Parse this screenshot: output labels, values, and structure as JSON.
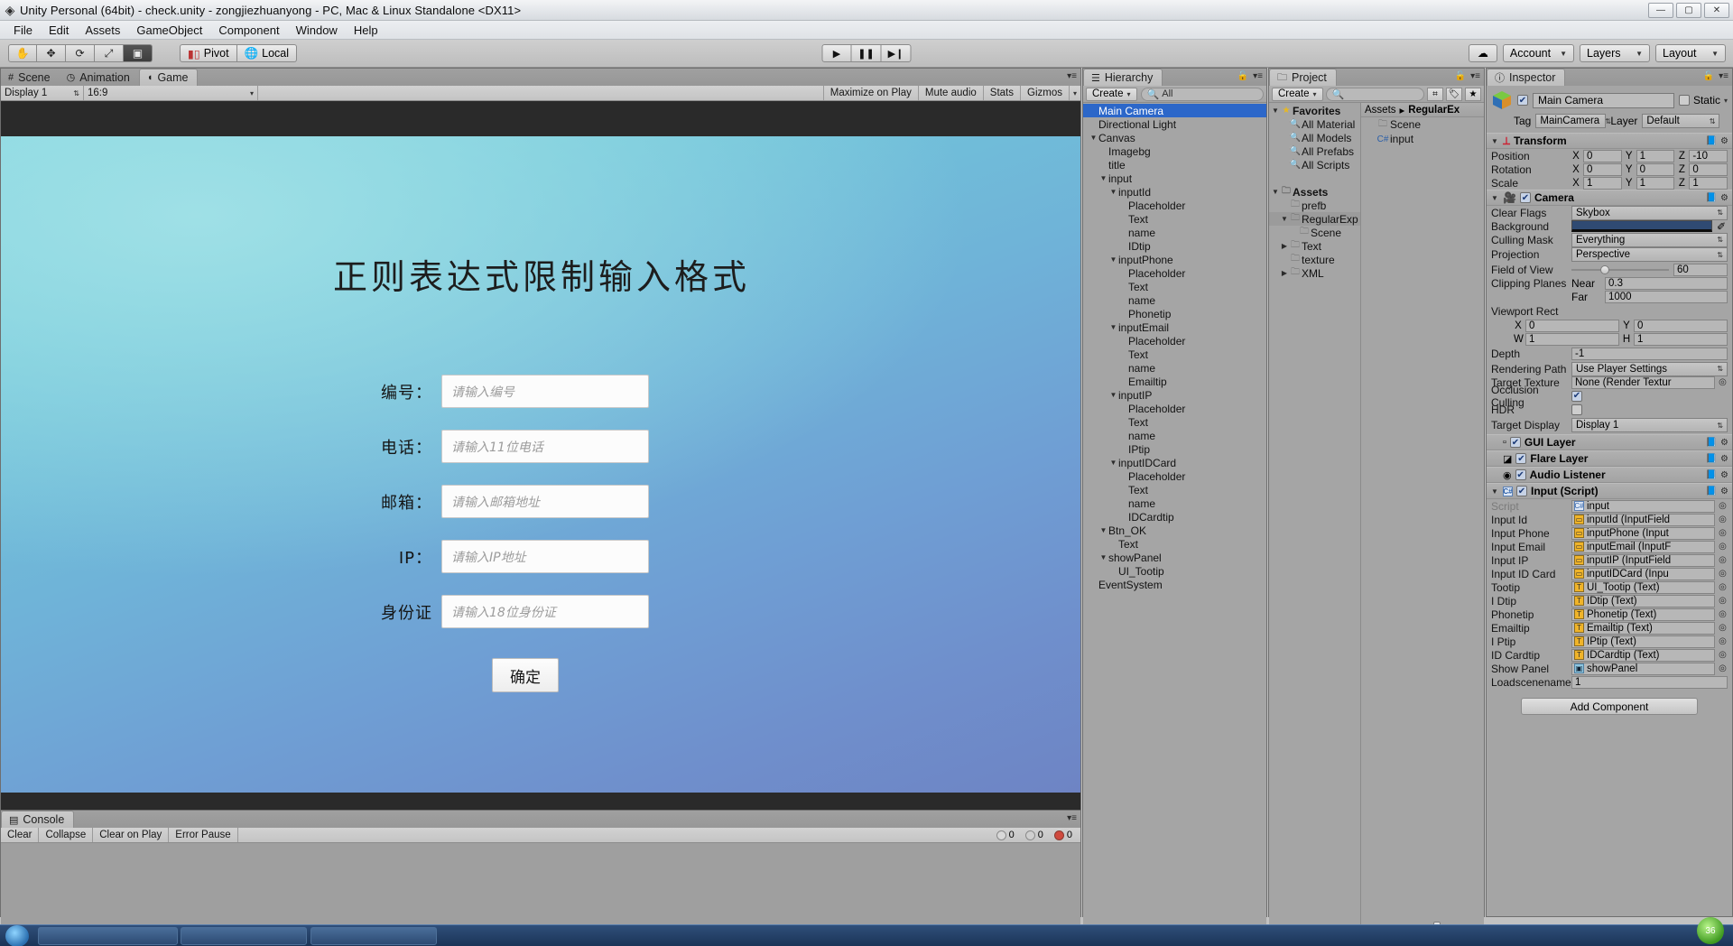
{
  "window": {
    "title": "Unity Personal (64bit) - check.unity - zongjiezhuanyong - PC, Mac & Linux Standalone <DX11>",
    "logo": "unity-logo",
    "minimize": "—",
    "maximize": "▢",
    "close": "✕"
  },
  "menu": {
    "items": [
      "File",
      "Edit",
      "Assets",
      "GameObject",
      "Component",
      "Window",
      "Help"
    ]
  },
  "toolbar": {
    "tools": [
      {
        "name": "hand-tool",
        "glyph": "✋"
      },
      {
        "name": "move-tool",
        "glyph": "✥"
      },
      {
        "name": "rotate-tool",
        "glyph": "⟳"
      },
      {
        "name": "scale-tool",
        "glyph": "⤢"
      },
      {
        "name": "rect-tool",
        "glyph": "▣"
      }
    ],
    "pivot": "Pivot",
    "local": "Local",
    "play": "▶",
    "pause": "❚❚",
    "step": "▶❙",
    "cloud": "☁",
    "account": "Account",
    "layers": "Layers",
    "layout": "Layout"
  },
  "gameview": {
    "tabs": [
      {
        "label": "Scene",
        "icon": "grid-icon",
        "active": false
      },
      {
        "label": "Animation",
        "icon": "clock-icon",
        "active": false
      },
      {
        "label": "Game",
        "icon": "pacman-icon",
        "active": true
      }
    ],
    "display": "Display 1",
    "aspect": "16:9",
    "maximize_on_play": "Maximize on Play",
    "mute_audio": "Mute audio",
    "stats": "Stats",
    "gizmos": "Gizmos"
  },
  "game_content": {
    "title": "正则表达式限制输入格式",
    "fields": [
      {
        "label": "编号：",
        "placeholder": "请输入编号"
      },
      {
        "label": "电话：",
        "placeholder": "请输入11位电话"
      },
      {
        "label": "邮箱：",
        "placeholder": "请输入邮箱地址"
      },
      {
        "label": "IP：",
        "placeholder": "请输入IP地址"
      },
      {
        "label": "身份证",
        "placeholder": "请输入18位身份证"
      }
    ],
    "ok_button": "确定"
  },
  "console": {
    "tab": "Console",
    "buttons": [
      "Clear",
      "Collapse",
      "Clear on Play",
      "Error Pause"
    ],
    "counts": [
      {
        "type": "info",
        "value": "0",
        "color": "#d8d8d8"
      },
      {
        "type": "warning",
        "value": "0",
        "color": "#e8d36a"
      },
      {
        "type": "error",
        "value": "0",
        "color": "#cf4a3e"
      }
    ]
  },
  "hierarchy": {
    "tab": "Hierarchy",
    "create": "Create",
    "search_placeholder": "All",
    "items": [
      {
        "label": "Main Camera",
        "depth": 0,
        "arrow": "",
        "selected": true
      },
      {
        "label": "Directional Light",
        "depth": 0,
        "arrow": "",
        "selected": false
      },
      {
        "label": "Canvas",
        "depth": 0,
        "arrow": "▼",
        "selected": false
      },
      {
        "label": "Imagebg",
        "depth": 1,
        "arrow": "",
        "selected": false
      },
      {
        "label": "title",
        "depth": 1,
        "arrow": "",
        "selected": false
      },
      {
        "label": "input",
        "depth": 1,
        "arrow": "▼",
        "selected": false
      },
      {
        "label": "inputId",
        "depth": 2,
        "arrow": "▼",
        "selected": false
      },
      {
        "label": "Placeholder",
        "depth": 3,
        "arrow": "",
        "selected": false
      },
      {
        "label": "Text",
        "depth": 3,
        "arrow": "",
        "selected": false
      },
      {
        "label": "name",
        "depth": 3,
        "arrow": "",
        "selected": false
      },
      {
        "label": "IDtip",
        "depth": 3,
        "arrow": "",
        "selected": false
      },
      {
        "label": "inputPhone",
        "depth": 2,
        "arrow": "▼",
        "selected": false
      },
      {
        "label": "Placeholder",
        "depth": 3,
        "arrow": "",
        "selected": false
      },
      {
        "label": "Text",
        "depth": 3,
        "arrow": "",
        "selected": false
      },
      {
        "label": "name",
        "depth": 3,
        "arrow": "",
        "selected": false
      },
      {
        "label": "Phonetip",
        "depth": 3,
        "arrow": "",
        "selected": false
      },
      {
        "label": "inputEmail",
        "depth": 2,
        "arrow": "▼",
        "selected": false
      },
      {
        "label": "Placeholder",
        "depth": 3,
        "arrow": "",
        "selected": false
      },
      {
        "label": "Text",
        "depth": 3,
        "arrow": "",
        "selected": false
      },
      {
        "label": "name",
        "depth": 3,
        "arrow": "",
        "selected": false
      },
      {
        "label": "Emailtip",
        "depth": 3,
        "arrow": "",
        "selected": false
      },
      {
        "label": "inputIP",
        "depth": 2,
        "arrow": "▼",
        "selected": false
      },
      {
        "label": "Placeholder",
        "depth": 3,
        "arrow": "",
        "selected": false
      },
      {
        "label": "Text",
        "depth": 3,
        "arrow": "",
        "selected": false
      },
      {
        "label": "name",
        "depth": 3,
        "arrow": "",
        "selected": false
      },
      {
        "label": "IPtip",
        "depth": 3,
        "arrow": "",
        "selected": false
      },
      {
        "label": "inputIDCard",
        "depth": 2,
        "arrow": "▼",
        "selected": false
      },
      {
        "label": "Placeholder",
        "depth": 3,
        "arrow": "",
        "selected": false
      },
      {
        "label": "Text",
        "depth": 3,
        "arrow": "",
        "selected": false
      },
      {
        "label": "name",
        "depth": 3,
        "arrow": "",
        "selected": false
      },
      {
        "label": "IDCardtip",
        "depth": 3,
        "arrow": "",
        "selected": false
      },
      {
        "label": "Btn_OK",
        "depth": 1,
        "arrow": "▼",
        "selected": false
      },
      {
        "label": "Text",
        "depth": 2,
        "arrow": "",
        "selected": false
      },
      {
        "label": "showPanel",
        "depth": 1,
        "arrow": "▼",
        "selected": false
      },
      {
        "label": "UI_Tootip",
        "depth": 2,
        "arrow": "",
        "selected": false
      },
      {
        "label": "EventSystem",
        "depth": 0,
        "arrow": "",
        "selected": false
      }
    ]
  },
  "project": {
    "tab": "Project",
    "create": "Create",
    "search_placeholder": "",
    "breadcrumb": [
      "Assets",
      "RegularEx"
    ],
    "tree": [
      {
        "label": "Favorites",
        "depth": 0,
        "arrow": "▼",
        "icon": "star-icon",
        "bold": true,
        "selected": false
      },
      {
        "label": "All Material",
        "depth": 1,
        "arrow": "",
        "icon": "search-icon",
        "bold": false,
        "selected": false
      },
      {
        "label": "All Models",
        "depth": 1,
        "arrow": "",
        "icon": "search-icon",
        "bold": false,
        "selected": false
      },
      {
        "label": "All Prefabs",
        "depth": 1,
        "arrow": "",
        "icon": "search-icon",
        "bold": false,
        "selected": false
      },
      {
        "label": "All Scripts",
        "depth": 1,
        "arrow": "",
        "icon": "search-icon",
        "bold": false,
        "selected": false
      },
      {
        "label": "",
        "depth": 0,
        "arrow": "",
        "icon": "",
        "bold": false,
        "selected": false
      },
      {
        "label": "Assets",
        "depth": 0,
        "arrow": "▼",
        "icon": "folder-icon",
        "bold": true,
        "selected": false
      },
      {
        "label": "prefb",
        "depth": 1,
        "arrow": "",
        "icon": "folder-icon",
        "bold": false,
        "selected": false
      },
      {
        "label": "RegularExp",
        "depth": 1,
        "arrow": "▼",
        "icon": "folder-icon",
        "bold": false,
        "selected": true
      },
      {
        "label": "Scene",
        "depth": 2,
        "arrow": "",
        "icon": "folder-icon",
        "bold": false,
        "selected": false
      },
      {
        "label": "Text",
        "depth": 1,
        "arrow": "▶",
        "icon": "folder-icon",
        "bold": false,
        "selected": false
      },
      {
        "label": "texture",
        "depth": 1,
        "arrow": "",
        "icon": "folder-icon",
        "bold": false,
        "selected": false
      },
      {
        "label": "XML",
        "depth": 1,
        "arrow": "▶",
        "icon": "folder-icon",
        "bold": false,
        "selected": false
      }
    ],
    "contents": [
      {
        "label": "Scene",
        "icon": "folder-icon"
      },
      {
        "label": "input",
        "icon": "csharp-icon"
      }
    ]
  },
  "inspector": {
    "tab": "Inspector",
    "object_name": "Main Camera",
    "enabled": true,
    "static_label": "Static",
    "tag_label": "Tag",
    "tag_value": "MainCamera",
    "layer_label": "Layer",
    "layer_value": "Default",
    "transform": {
      "title": "Transform",
      "rows": [
        {
          "label": "Position",
          "x": "0",
          "y": "1",
          "z": "-10"
        },
        {
          "label": "Rotation",
          "x": "0",
          "y": "0",
          "z": "0"
        },
        {
          "label": "Scale",
          "x": "1",
          "y": "1",
          "z": "1"
        }
      ]
    },
    "camera": {
      "title": "Camera",
      "enabled": true,
      "clear_flags_label": "Clear Flags",
      "clear_flags_value": "Skybox",
      "background_label": "Background",
      "background_color": "#2f4a72",
      "culling_mask_label": "Culling Mask",
      "culling_mask_value": "Everything",
      "projection_label": "Projection",
      "projection_value": "Perspective",
      "fov_label": "Field of View",
      "fov_value": "60",
      "clipping_label": "Clipping Planes",
      "near_label": "Near",
      "near_value": "0.3",
      "far_label": "Far",
      "far_value": "1000",
      "viewport_label": "Viewport Rect",
      "viewport_x": "0",
      "viewport_y": "0",
      "viewport_w": "1",
      "viewport_h": "1",
      "depth_label": "Depth",
      "depth_value": "-1",
      "rendering_path_label": "Rendering Path",
      "rendering_path_value": "Use Player Settings",
      "target_texture_label": "Target Texture",
      "target_texture_value": "None (Render Textur",
      "occlusion_label": "Occlusion Culling",
      "occlusion_checked": true,
      "hdr_label": "HDR",
      "hdr_checked": false,
      "target_display_label": "Target Display",
      "target_display_value": "Display 1"
    },
    "components": [
      {
        "title": "GUI Layer",
        "icon": "gui-layer-icon",
        "enabled": true
      },
      {
        "title": "Flare Layer",
        "icon": "flare-layer-icon",
        "enabled": true
      },
      {
        "title": "Audio Listener",
        "icon": "audio-listener-icon",
        "enabled": true
      }
    ],
    "script_component": {
      "title": "Input (Script)",
      "enabled": true,
      "rows": [
        {
          "label": "Script",
          "value": "input",
          "kind": "cs",
          "dim": true
        },
        {
          "label": "Input Id",
          "value": "inputId (InputField",
          "kind": "field",
          "dim": false
        },
        {
          "label": "Input Phone",
          "value": "inputPhone (Input",
          "kind": "field",
          "dim": false
        },
        {
          "label": "Input Email",
          "value": "inputEmail (InputF",
          "kind": "field",
          "dim": false
        },
        {
          "label": "Input IP",
          "value": "inputIP (InputField",
          "kind": "field",
          "dim": false
        },
        {
          "label": "Input ID Card",
          "value": "inputIDCard (Inpu",
          "kind": "field",
          "dim": false
        },
        {
          "label": "Tootip",
          "value": "UI_Tootip (Text)",
          "kind": "text",
          "dim": false
        },
        {
          "label": "I Dtip",
          "value": "IDtip (Text)",
          "kind": "text",
          "dim": false
        },
        {
          "label": "Phonetip",
          "value": "Phonetip  (Text)",
          "kind": "text",
          "dim": false
        },
        {
          "label": "Emailtip",
          "value": "Emailtip  (Text)",
          "kind": "text",
          "dim": false
        },
        {
          "label": "I Ptip",
          "value": "IPtip (Text)",
          "kind": "text",
          "dim": false
        },
        {
          "label": "ID Cardtip",
          "value": "IDCardtip (Text)",
          "kind": "text",
          "dim": false
        },
        {
          "label": "Show Panel",
          "value": "showPanel",
          "kind": "prefab",
          "dim": false
        },
        {
          "label": "Loadscenename",
          "value": "1",
          "kind": "plain",
          "dim": false
        }
      ]
    },
    "add_component": "Add Component"
  }
}
